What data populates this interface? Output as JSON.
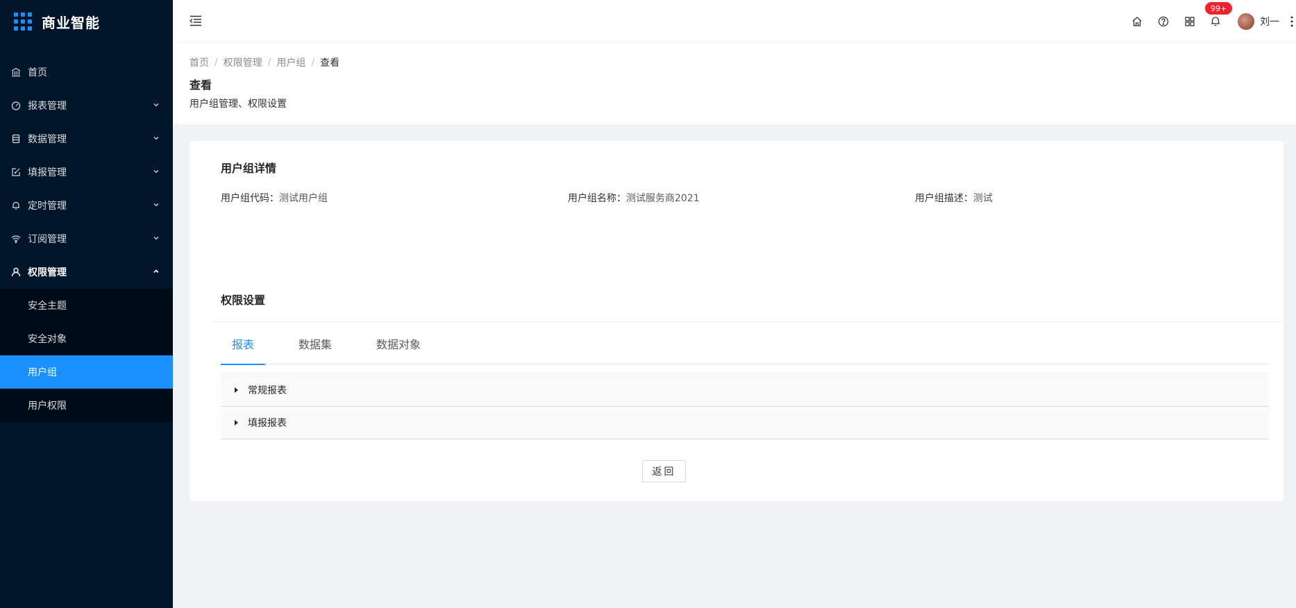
{
  "app": {
    "title": "商业智能"
  },
  "sidebar": {
    "items": [
      {
        "label": "首页",
        "icon": "bank-icon"
      },
      {
        "label": "报表管理",
        "icon": "dashboard-icon"
      },
      {
        "label": "数据管理",
        "icon": "database-icon"
      },
      {
        "label": "填报管理",
        "icon": "edit-icon"
      },
      {
        "label": "定时管理",
        "icon": "bell-icon"
      },
      {
        "label": "订阅管理",
        "icon": "wifi-icon"
      },
      {
        "label": "权限管理",
        "icon": "user-icon"
      }
    ],
    "submenu": [
      {
        "label": "安全主题"
      },
      {
        "label": "安全对象"
      },
      {
        "label": "用户组",
        "active": true
      },
      {
        "label": "用户权限"
      }
    ]
  },
  "header": {
    "notification_count": "99+",
    "username": "刘一",
    "icons": [
      "home-icon",
      "question-icon",
      "apps-icon",
      "bell-icon",
      "more-icon"
    ]
  },
  "breadcrumb": [
    "首页",
    "权限管理",
    "用户组",
    "查看"
  ],
  "page": {
    "title": "查看",
    "description": "用户组管理、权限设置"
  },
  "detail": {
    "title": "用户组详情",
    "fields": [
      {
        "label": "用户组代码：",
        "value": "测试用户组"
      },
      {
        "label": "用户组名称：",
        "value": "测试服务商2021"
      },
      {
        "label": "用户组描述：",
        "value": "测试"
      }
    ]
  },
  "permissions": {
    "title": "权限设置",
    "tabs": [
      {
        "label": "报表",
        "active": true
      },
      {
        "label": "数据集"
      },
      {
        "label": "数据对象"
      }
    ],
    "panels": [
      {
        "label": "常规报表"
      },
      {
        "label": "填报报表"
      }
    ]
  },
  "actions": {
    "back_label": "返回"
  },
  "colors": {
    "sidebar_bg": "#001529",
    "accent": "#1890ff",
    "badge": "#f5222d"
  }
}
